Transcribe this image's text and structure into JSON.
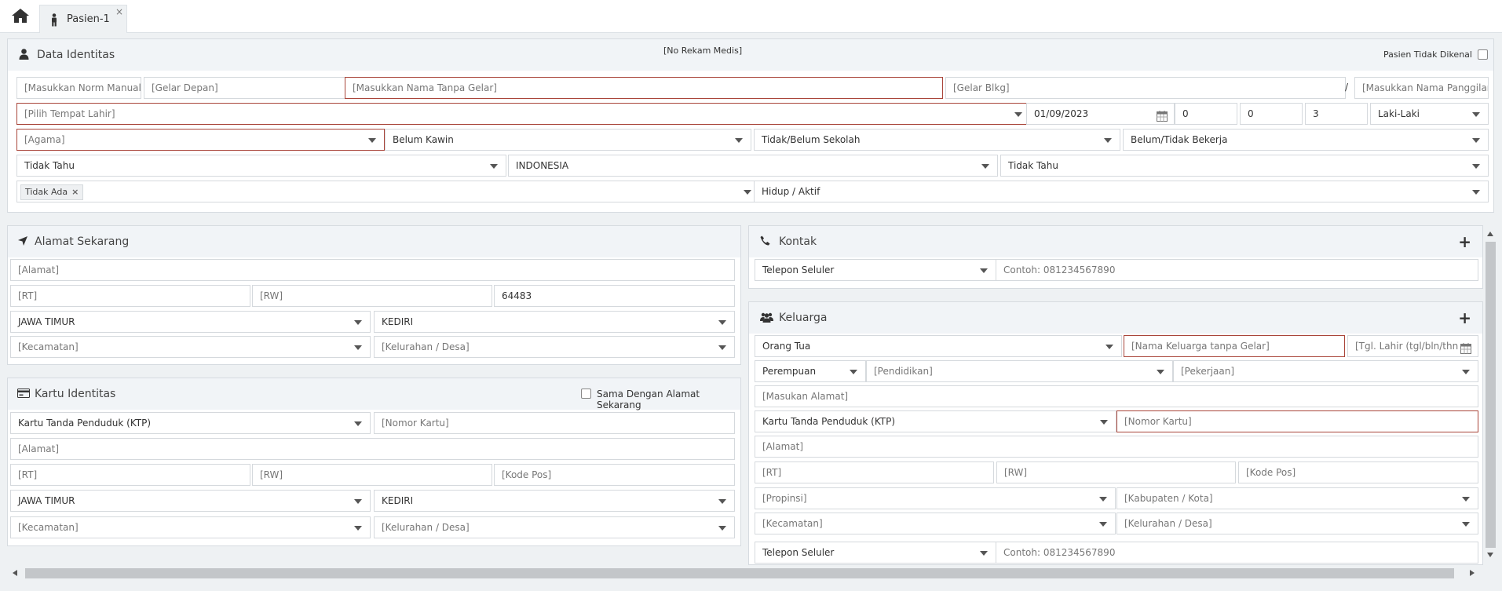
{
  "tabs": [
    {
      "label": "Pasien-1",
      "close": "×"
    }
  ],
  "identitas": {
    "title": "Data Identitas",
    "rekam_medis": "[No Rekam Medis]",
    "tidak_dikenal_label": "Pasien Tidak Dikenal",
    "norm": "[Masukkan Norm Manual]",
    "gelar_depan": "[Gelar Depan]",
    "nama": "[Masukkan Nama Tanpa Gelar]",
    "gelar_blkg": "[Gelar Blkg]",
    "slash": "/",
    "panggilan": "[Masukkan Nama Panggilan]",
    "tempat_lahir": "[Pilih Tempat Lahir]",
    "tgl_lahir": "01/09/2023",
    "umur_tahun": "0",
    "umur_bulan": "0",
    "umur_hari": "3",
    "jenis_kelamin": "Laki-Laki",
    "agama": "[Agama]",
    "status_kawin": "Belum Kawin",
    "pendidikan": "Tidak/Belum Sekolah",
    "pekerjaan": "Belum/Tidak Bekerja",
    "gol_darah": "Tidak Tahu",
    "kewarganegaraan": "INDONESIA",
    "suku": "Tidak Tahu",
    "alergi_chip": "Tidak Ada",
    "chip_remove": "×",
    "status_hidup": "Hidup / Aktif"
  },
  "alamat": {
    "title": "Alamat Sekarang",
    "alamat": "[Alamat]",
    "rt": "[RT]",
    "rw": "[RW]",
    "kode_pos": "64483",
    "propinsi": "JAWA TIMUR",
    "kabupaten": "KEDIRI",
    "kecamatan": "[Kecamatan]",
    "kelurahan": "[Kelurahan / Desa]"
  },
  "kartu": {
    "title": "Kartu Identitas",
    "same_label": "Sama Dengan Alamat Sekarang",
    "jenis": "Kartu Tanda Penduduk (KTP)",
    "nomor": "[Nomor Kartu]",
    "alamat": "[Alamat]",
    "rt": "[RT]",
    "rw": "[RW]",
    "kode_pos": "[Kode Pos]",
    "propinsi": "JAWA TIMUR",
    "kabupaten": "KEDIRI",
    "kecamatan": "[Kecamatan]",
    "kelurahan": "[Kelurahan / Desa]"
  },
  "kontak": {
    "title": "Kontak",
    "jenis": "Telepon Seluler",
    "nomor": "Contoh: 081234567890"
  },
  "keluarga": {
    "title": "Keluarga",
    "hubungan": "Orang Tua",
    "nama": "[Nama Keluarga tanpa Gelar]",
    "tgl_lahir": "[Tgl. Lahir (tgl/bln/thn",
    "jenis_kelamin": "Perempuan",
    "pendidikan": "[Pendidikan]",
    "pekerjaan": "[Pekerjaan]",
    "alamat_masukan": "[Masukan Alamat]",
    "kartu_jenis": "Kartu Tanda Penduduk (KTP)",
    "kartu_nomor": "[Nomor Kartu]",
    "alamat": "[Alamat]",
    "rt": "[RT]",
    "rw": "[RW]",
    "kode_pos": "[Kode Pos]",
    "propinsi": "[Propinsi]",
    "kabupaten": "[Kabupaten / Kota]",
    "kecamatan": "[Kecamatan]",
    "kelurahan": "[Kelurahan / Desa]",
    "kontak_jenis": "Telepon Seluler",
    "kontak_nomor": "Contoh: 081234567890"
  }
}
